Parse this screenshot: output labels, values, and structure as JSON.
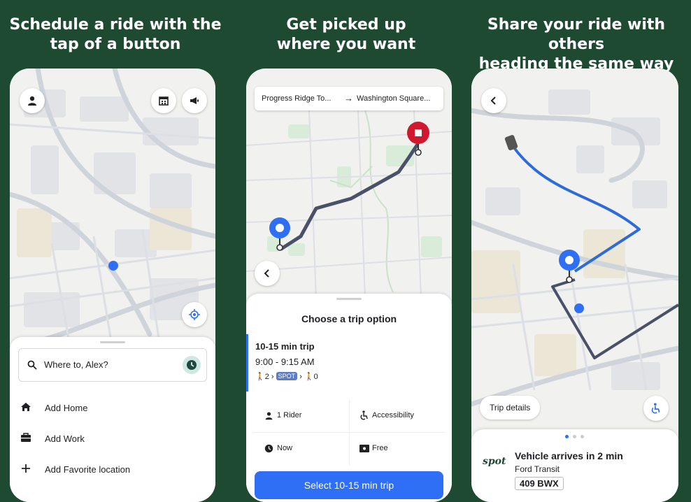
{
  "panels": [
    {
      "caption_line1": "Schedule a ride with the",
      "caption_line2": "tap of a button",
      "search_placeholder": "Where to, Alex?",
      "menu": [
        {
          "icon": "home-icon",
          "label": "Add Home"
        },
        {
          "icon": "briefcase-icon",
          "label": "Add Work"
        },
        {
          "icon": "plus-icon",
          "label": "Add Favorite location"
        }
      ]
    },
    {
      "caption_line1": "Get picked up",
      "caption_line2": "where you want",
      "route_from": "Progress Ridge To...",
      "route_to": "Washington Square...",
      "sheet_title": "Choose a trip option",
      "trip_name": "10-15 min trip",
      "trip_time": "9:00 - 9:15 AM",
      "walk_before": "2",
      "spot_label": "SPOT",
      "walk_after": "0",
      "options": {
        "riders": "1 Rider",
        "accessibility": "Accessibility",
        "when": "Now",
        "price": "Free"
      },
      "select_button": "Select 10-15 min trip"
    },
    {
      "caption_line1": "Share your ride with others",
      "caption_line2": "heading the same way",
      "trip_details": "Trip details",
      "brand": "spot",
      "vehicle_status": "Vehicle arrives in 2 min",
      "vehicle_model": "Ford Transit",
      "plate": "409 BWX"
    }
  ],
  "colors": {
    "background": "#1f4a32",
    "map_land": "#f1f1ef",
    "road": "#cfd3da",
    "route_dark": "#4a5068",
    "route_blue": "#2f6bd8",
    "pin_blue": "#2f6ff5",
    "pin_red": "#d0192e",
    "button_blue": "#2f6ff5"
  }
}
